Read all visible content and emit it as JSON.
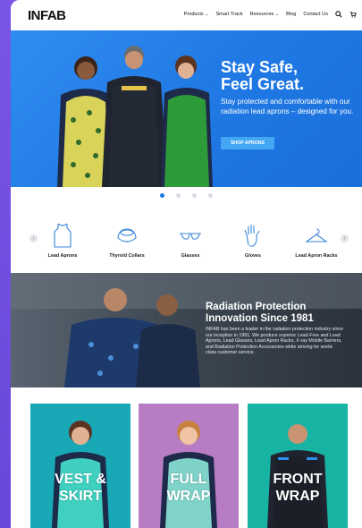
{
  "header": {
    "logo": "INFAB",
    "nav": [
      {
        "label": "Products",
        "has_caret": true
      },
      {
        "label": "Smart Track",
        "has_caret": false
      },
      {
        "label": "Resources",
        "has_caret": true
      },
      {
        "label": "Blog",
        "has_caret": false
      },
      {
        "label": "Contact Us",
        "has_caret": false
      }
    ],
    "caret_glyph": "⌄"
  },
  "hero": {
    "title_line1": "Stay Safe,",
    "title_line2": "Feel Great.",
    "text": "Stay protected and comfortable with our radiation lead aprons – designed for you.",
    "button": "SHOP APRONS",
    "slide_count": 4,
    "active_slide": 1
  },
  "categories": {
    "prev_glyph": "‹",
    "next_glyph": "›",
    "items": [
      {
        "label": "Lead Aprons",
        "icon": "apron-icon"
      },
      {
        "label": "Thyroid Collars",
        "icon": "thyroid-collar-icon"
      },
      {
        "label": "Glasses",
        "icon": "glasses-icon"
      },
      {
        "label": "Gloves",
        "icon": "gloves-icon"
      },
      {
        "label": "Lead Apron Racks",
        "icon": "hanger-icon"
      }
    ]
  },
  "innovation": {
    "title_line1": "Radiation Protection",
    "title_line2": "Innovation Since 1981",
    "text": "INFAB has been a leader in the radiation protection industry since our inception in 1981. We produce superior Lead-Free and Lead Aprons, Lead Glasses, Lead Apron Racks, X-ray Mobile Barriers, and Radiation Protection Accessories while striving for world-class customer service."
  },
  "products": [
    {
      "title_line1": "VEST &",
      "title_line2": "SKIRT",
      "bg": "#19a8b5"
    },
    {
      "title_line1": "FULL",
      "title_line2": "WRAP",
      "bg": "#b87cc4"
    },
    {
      "title_line1": "FRONT",
      "title_line2": "WRAP",
      "bg": "#17b3a3"
    }
  ],
  "colors": {
    "accent": "#1f78e3",
    "hero_bg": "#2184ea",
    "button": "#44a7f3"
  }
}
